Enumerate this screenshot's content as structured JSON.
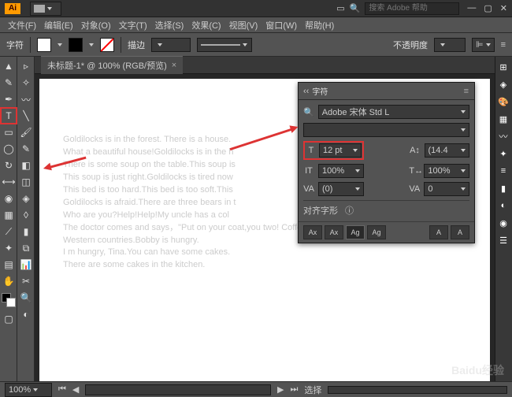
{
  "titlebar": {
    "app_logo": "Ai",
    "search_placeholder": "搜索 Adobe 帮助"
  },
  "menu": {
    "file": "文件(F)",
    "edit": "编辑(E)",
    "object": "对象(O)",
    "type": "文字(T)",
    "select": "选择(S)",
    "effect": "效果(C)",
    "view": "视图(V)",
    "window": "窗口(W)",
    "help": "帮助(H)"
  },
  "controlbar": {
    "char_label": "字符",
    "stroke_label": "描边",
    "stroke_value": "",
    "opacity_label": "不透明度",
    "opacity_value": ""
  },
  "doc": {
    "tab_title": "未标题-1* @ 100% (RGB/预览)"
  },
  "text_lines": [
    "Goldilocks is in the forest. There is a house.",
    "What a beautiful house!Goldilocks is in the h",
    "There is some soup on the table.This soup is",
    "This soup is just right.Goldilocks is tired now",
    "This bed is too hard.This bed is too soft.This",
    "Goldilocks is afraid.There are three bears in t",
    "Who are you?Help!Help!My uncle has a col",
    "The doctor comes and says，\"Put on your coat,you two!     Coffee is popular in",
    "Western countries.Bobby is hungry.",
    "I m hungry, Tina.You can have some cakes.",
    "There are some cakes in the kitchen."
  ],
  "charpanel": {
    "title": "字符",
    "font_family": "Adobe 宋体 Std L",
    "font_style": "",
    "font_size": "12 pt",
    "leading": "(14.4",
    "vscale": "100%",
    "hscale": "100%",
    "kerning": "(0)",
    "tracking": "0",
    "align_label": "对齐字形"
  },
  "status": {
    "zoom": "100%",
    "select_label": "选择"
  },
  "watermark": "Baidu经验"
}
